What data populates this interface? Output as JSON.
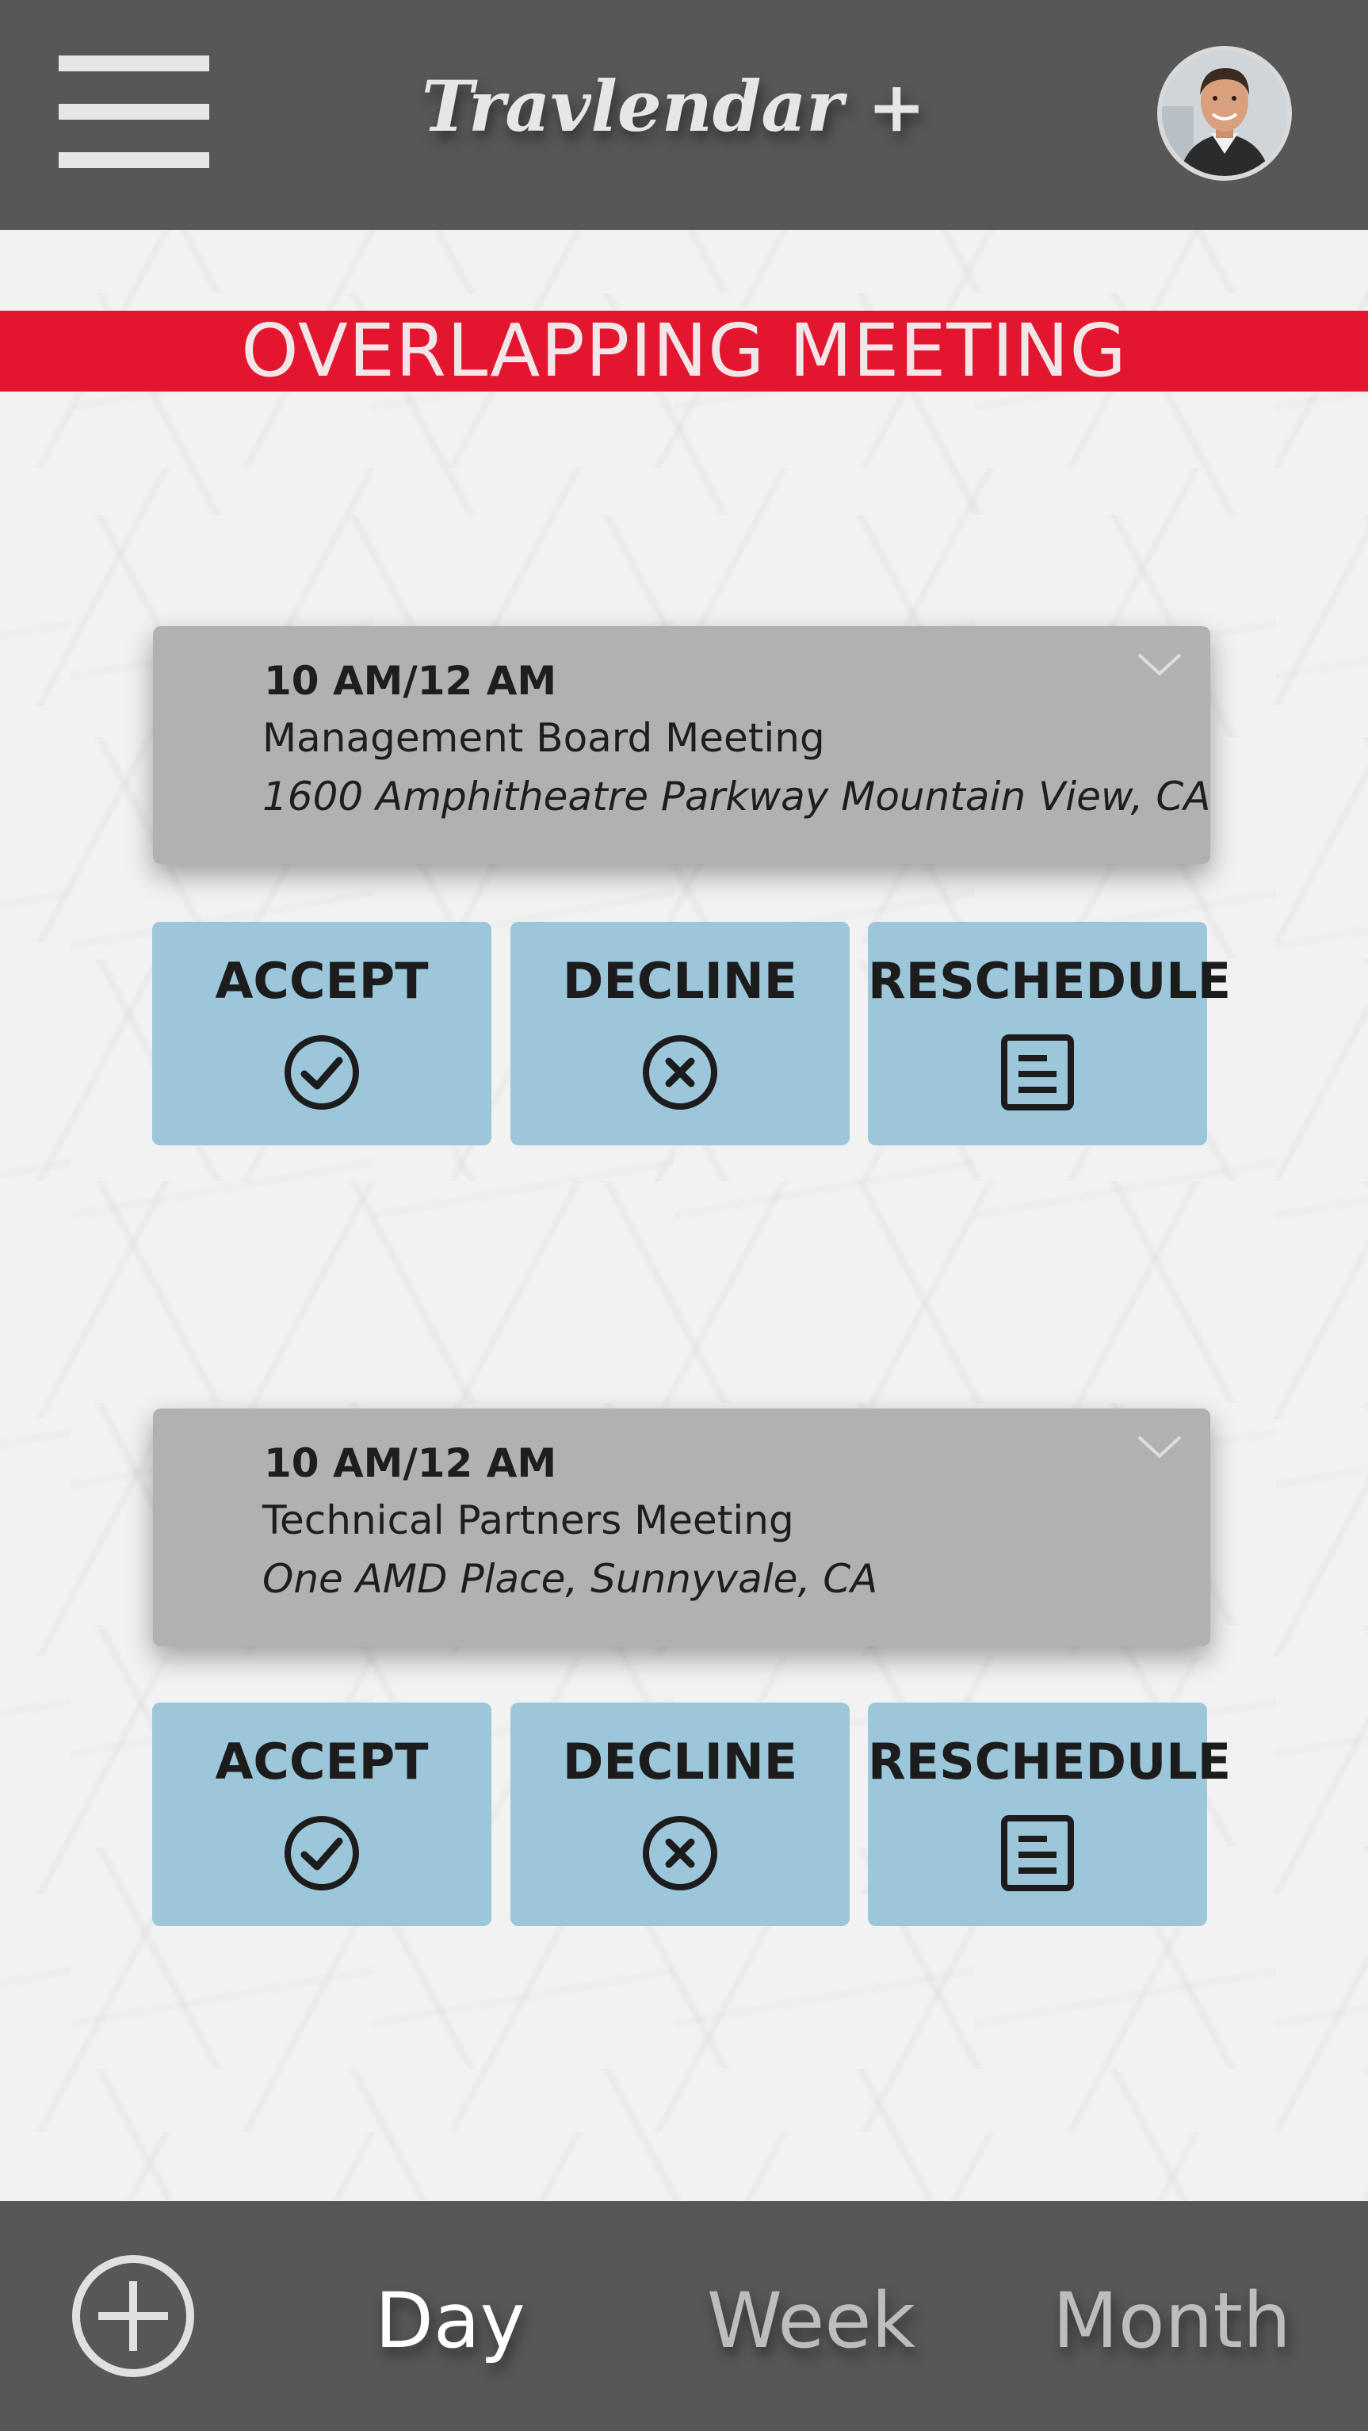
{
  "header": {
    "title": "Travlendar +",
    "menu_icon": "hamburger-menu-icon",
    "avatar_icon": "user-avatar"
  },
  "banner": {
    "text": "OVERLAPPING MEETING",
    "color": "#e4162f"
  },
  "meetings": [
    {
      "time": "10 AM/12 AM",
      "name": "Management Board Meeting",
      "address": "1600 Amphitheatre Parkway Mountain View, CA",
      "actions": {
        "accept": "ACCEPT",
        "decline": "DECLINE",
        "reschedule": "RESCHEDULE"
      }
    },
    {
      "time": "10 AM/12 AM",
      "name": "Technical Partners Meeting",
      "address": "One AMD Place, Sunnyvale, CA",
      "actions": {
        "accept": "ACCEPT",
        "decline": "DECLINE",
        "reschedule": "RESCHEDULE"
      }
    }
  ],
  "bottom_nav": {
    "add_icon": "plus-circle-icon",
    "tabs": [
      "Day",
      "Week",
      "Month"
    ],
    "active_tab": "Day"
  },
  "colors": {
    "bar": "#575757",
    "card": "#b1b1b1",
    "action_button": "#9cc6da",
    "banner": "#e4162f"
  }
}
